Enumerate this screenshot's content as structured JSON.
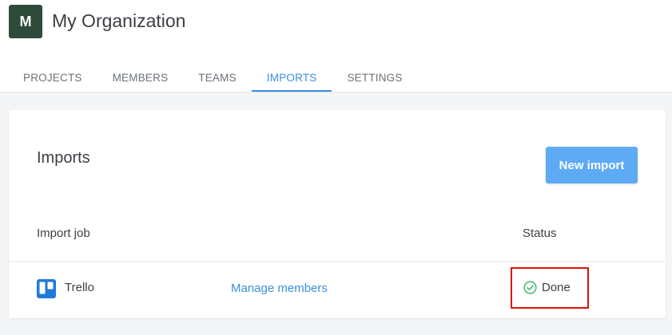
{
  "org": {
    "avatar_letter": "M",
    "name": "My Organization",
    "avatar_color": "#2d4a3a"
  },
  "tabs": [
    {
      "label": "PROJECTS",
      "active": false
    },
    {
      "label": "MEMBERS",
      "active": false
    },
    {
      "label": "TEAMS",
      "active": false
    },
    {
      "label": "IMPORTS",
      "active": true
    },
    {
      "label": "SETTINGS",
      "active": false
    }
  ],
  "imports": {
    "title": "Imports",
    "new_button_label": "New import",
    "columns": {
      "job": "Import job",
      "status": "Status"
    },
    "rows": [
      {
        "icon": "trello-icon",
        "name": "Trello",
        "action_label": "Manage members",
        "status": "Done",
        "status_icon": "check-circle-icon",
        "status_color": "#3dbb6b"
      }
    ]
  },
  "colors": {
    "accent": "#3c8ee0",
    "button": "#5eaaf5",
    "highlight": "#e01010"
  }
}
